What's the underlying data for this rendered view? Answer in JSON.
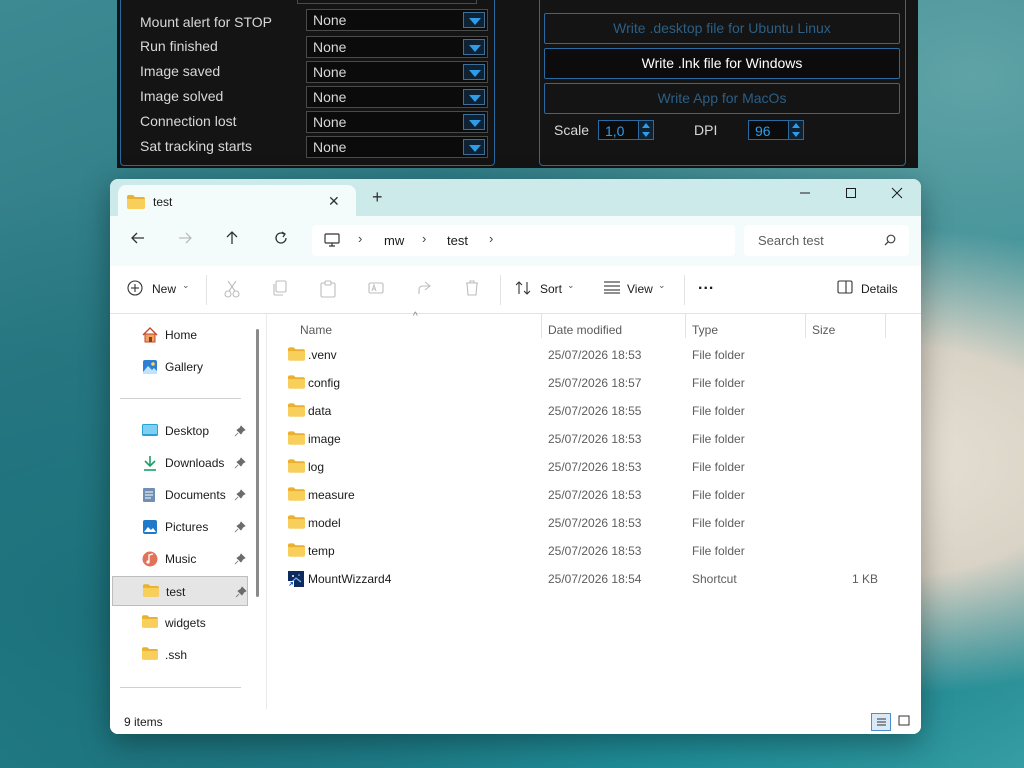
{
  "mw": {
    "alerts": [
      {
        "label": "Mount alert for STOP",
        "value": "None"
      },
      {
        "label": "Run finished",
        "value": "None"
      },
      {
        "label": "Image saved",
        "value": "None"
      },
      {
        "label": "Image solved",
        "value": "None"
      },
      {
        "label": "Connection lost",
        "value": "None"
      },
      {
        "label": "Sat tracking starts",
        "value": "None"
      }
    ],
    "buttons": {
      "ubuntu": "Write .desktop file for Ubuntu Linux",
      "windows": "Write .lnk file for Windows",
      "macos": "Write App for MacOs"
    },
    "scale_label": "Scale",
    "scale_value": "1,0",
    "dpi_label": "DPI",
    "dpi_value": "96"
  },
  "explorer": {
    "tab_title": "test",
    "breadcrumb": [
      "mw",
      "test"
    ],
    "search_placeholder": "Search test",
    "toolbar": {
      "new_label": "New",
      "sort_label": "Sort",
      "view_label": "View",
      "more_label": "...",
      "details_label": "Details"
    },
    "sidebar": {
      "top": [
        {
          "label": "Home",
          "icon": "home-icon"
        },
        {
          "label": "Gallery",
          "icon": "gallery-icon"
        }
      ],
      "quick": [
        {
          "label": "Desktop",
          "icon": "desktop-icon",
          "pinned": true
        },
        {
          "label": "Downloads",
          "icon": "download-icon",
          "pinned": true
        },
        {
          "label": "Documents",
          "icon": "documents-icon",
          "pinned": true
        },
        {
          "label": "Pictures",
          "icon": "pictures-icon",
          "pinned": true
        },
        {
          "label": "Music",
          "icon": "music-icon",
          "pinned": true
        },
        {
          "label": "test",
          "icon": "folder-icon",
          "pinned": true,
          "selected": true
        },
        {
          "label": "widgets",
          "icon": "folder-icon",
          "pinned": false
        },
        {
          "label": ".ssh",
          "icon": "folder-icon",
          "pinned": false
        }
      ]
    },
    "columns": {
      "name": "Name",
      "date": "Date modified",
      "type": "Type",
      "size": "Size"
    },
    "files": [
      {
        "name": ".venv",
        "date": "25/07/2026 18:53",
        "type": "File folder",
        "size": "",
        "icon": "folder-icon"
      },
      {
        "name": "config",
        "date": "25/07/2026 18:57",
        "type": "File folder",
        "size": "",
        "icon": "folder-icon"
      },
      {
        "name": "data",
        "date": "25/07/2026 18:55",
        "type": "File folder",
        "size": "",
        "icon": "folder-icon"
      },
      {
        "name": "image",
        "date": "25/07/2026 18:53",
        "type": "File folder",
        "size": "",
        "icon": "folder-icon"
      },
      {
        "name": "log",
        "date": "25/07/2026 18:53",
        "type": "File folder",
        "size": "",
        "icon": "folder-icon"
      },
      {
        "name": "measure",
        "date": "25/07/2026 18:53",
        "type": "File folder",
        "size": "",
        "icon": "folder-icon"
      },
      {
        "name": "model",
        "date": "25/07/2026 18:53",
        "type": "File folder",
        "size": "",
        "icon": "folder-icon"
      },
      {
        "name": "temp",
        "date": "25/07/2026 18:53",
        "type": "File folder",
        "size": "",
        "icon": "folder-icon"
      },
      {
        "name": "MountWizzard4",
        "date": "25/07/2026 18:54",
        "type": "Shortcut",
        "size": "1 KB",
        "icon": "shortcut-icon"
      }
    ],
    "status_count": "9 items"
  },
  "colors": {
    "mw_background": "#141414",
    "mw_accent": "#2a6aa0",
    "mw_arrow": "#2e9ce8",
    "explorer_title_bg": "#cceaea",
    "folder_yellow": "#f4c542"
  }
}
